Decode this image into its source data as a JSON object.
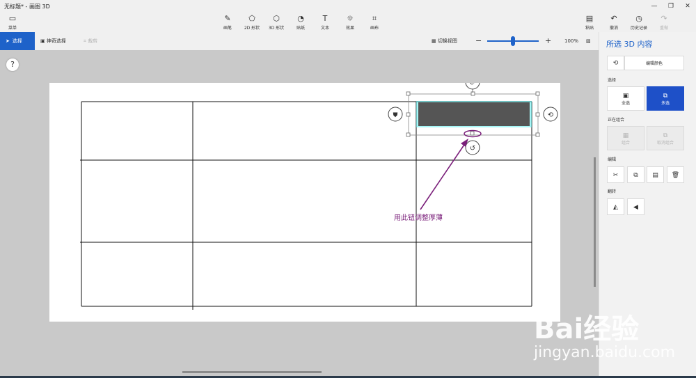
{
  "window": {
    "title": "无标题* - 画图 3D",
    "minimize_icon": "—",
    "maximize_icon": "❐",
    "close_icon": "✕"
  },
  "ribbon": {
    "menu": {
      "icon": "folder-icon",
      "label": "菜单"
    },
    "tools": [
      {
        "icon": "brush-icon",
        "label": "画笔"
      },
      {
        "icon": "2d-shapes-icon",
        "label": "2D 形状"
      },
      {
        "icon": "3d-shapes-icon",
        "label": "3D 形状"
      },
      {
        "icon": "sticker-icon",
        "label": "贴纸"
      },
      {
        "icon": "text-icon",
        "label": "文本"
      },
      {
        "icon": "effects-icon",
        "label": "效果"
      },
      {
        "icon": "canvas-icon",
        "label": "画布"
      }
    ],
    "right": [
      {
        "icon": "paste-icon",
        "label": "粘贴"
      },
      {
        "icon": "undo-icon",
        "label": "撤消"
      },
      {
        "icon": "history-icon",
        "label": "历史记录"
      },
      {
        "icon": "redo-icon",
        "label": "重做"
      }
    ]
  },
  "toolbar": {
    "select_label": "选择",
    "magic_select_label": "神奇选择",
    "crop_label": "裁剪",
    "switch_view_label": "切换视图",
    "zoom_minus": "−",
    "zoom_plus": "+",
    "zoom_level": "100%",
    "zoom_fraction": 0.5
  },
  "help": {
    "label": "?"
  },
  "canvas": {
    "annotation_text": "用此钮调整厚薄",
    "accent_color": "#7a1f7a",
    "selected_fill": "#555555",
    "highlight": "#5ff0f0"
  },
  "panel": {
    "title": "所选 3D 内容",
    "edit_color_label": "编辑颜色",
    "section_select": "选择",
    "select_all_label": "全选",
    "multi_select_label": "多选",
    "section_grouping": "正在组合",
    "group_label": "组合",
    "ungroup_label": "取消组合",
    "section_edit": "编辑",
    "section_flip": "翻转",
    "edit_icons": [
      "cut-icon",
      "copy-icon",
      "paste-icon",
      "delete-icon"
    ],
    "flip_icons": [
      "flip-horizontal-icon",
      "flip-vertical-icon"
    ]
  },
  "watermark": {
    "brand": "Bai经验",
    "url": "jingyan.baidu.com"
  }
}
